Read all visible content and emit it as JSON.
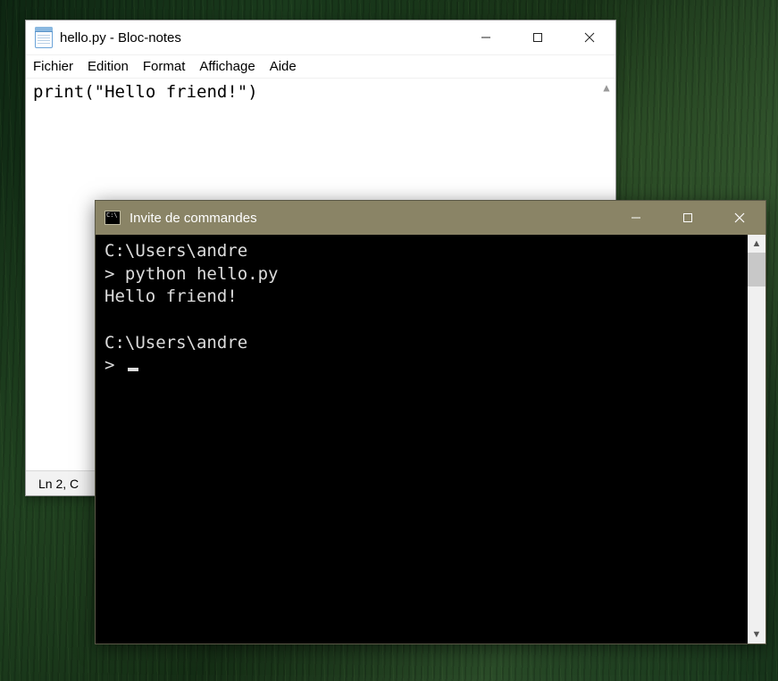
{
  "notepad": {
    "title": "hello.py - Bloc-notes",
    "menu": {
      "file": "Fichier",
      "edit": "Edition",
      "format": "Format",
      "view": "Affichage",
      "help": "Aide"
    },
    "content": "print(\"Hello friend!\")",
    "status": {
      "position": "Ln 2, C"
    }
  },
  "cmd": {
    "title": "Invite de commandes",
    "lines": {
      "l1": "C:\\Users\\andre",
      "l2": "> python hello.py",
      "l3": "Hello friend!",
      "l4": "",
      "l5": "C:\\Users\\andre",
      "l6": "> "
    }
  }
}
